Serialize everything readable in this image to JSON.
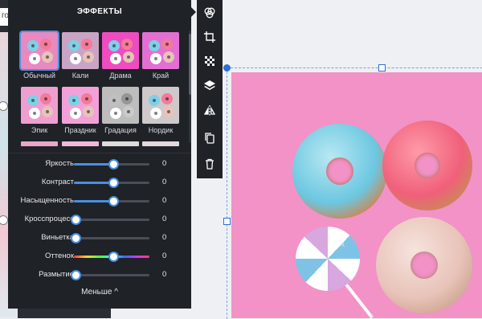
{
  "background": {
    "tab_fragment": "го"
  },
  "panel": {
    "title": "ЭФФЕКТЫ",
    "filters": [
      {
        "label": "Обычный",
        "tint": "#e889bf",
        "selected": true
      },
      {
        "label": "Кали",
        "tint": "#c9a4c4",
        "selected": false
      },
      {
        "label": "Драма",
        "tint": "#ee4cc0",
        "selected": false
      },
      {
        "label": "Край",
        "tint": "#e46fd2",
        "selected": false
      },
      {
        "label": "Эпик",
        "tint": "#ef9ed0",
        "selected": false
      },
      {
        "label": "Праздник",
        "tint": "#f2a1d8",
        "selected": false
      },
      {
        "label": "Градация",
        "tint": "#bdbdbd",
        "selected": false
      },
      {
        "label": "Нордик",
        "tint": "#cfc9cc",
        "selected": false
      }
    ],
    "sliders": [
      {
        "label": "Яркость",
        "value": "0",
        "level": 0.5
      },
      {
        "label": "Контраст",
        "value": "0",
        "level": 0.5
      },
      {
        "label": "Насыщенность",
        "value": "0",
        "level": 0.5
      },
      {
        "label": "Кросспроцесс",
        "value": "0",
        "level": 0
      },
      {
        "label": "Виньетка",
        "value": "0",
        "level": 0
      },
      {
        "label": "Оттенок",
        "value": "0",
        "level": 0.5,
        "hue": true
      },
      {
        "label": "Размытие",
        "value": "0",
        "level": 0
      }
    ],
    "less_label": "Меньше ^"
  },
  "toolbar": {
    "tools": [
      {
        "icon": "effects-circles-icon"
      },
      {
        "icon": "crop-icon"
      },
      {
        "icon": "transparency-icon"
      },
      {
        "icon": "layers-icon"
      },
      {
        "icon": "flip-icon"
      },
      {
        "icon": "duplicate-icon"
      },
      {
        "icon": "trash-icon"
      }
    ]
  },
  "colors": {
    "accent": "#4a8fe0",
    "panel_bg": "#1f2227",
    "canvas_pink": "#f292c6",
    "donut_blue": "#6cc7e0",
    "donut_pink": "#f0607a",
    "donut_glazed": "#e8c3b9"
  }
}
